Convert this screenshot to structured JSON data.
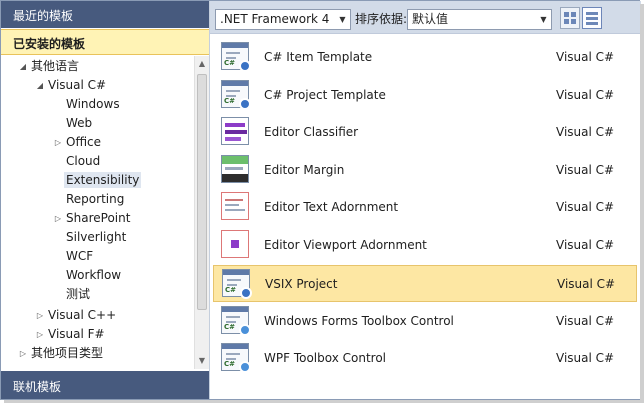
{
  "left_panel": {
    "recent_header": "最近的模板",
    "installed_header": "已安装的模板",
    "online_header": "联机模板",
    "tree": [
      {
        "label": "其他语言",
        "expanded": true,
        "depth": 0
      },
      {
        "label": "Visual C#",
        "expanded": true,
        "depth": 1
      },
      {
        "label": "Windows",
        "depth": 2
      },
      {
        "label": "Web",
        "depth": 2
      },
      {
        "label": "Office",
        "expanded": false,
        "depth": 2
      },
      {
        "label": "Cloud",
        "depth": 2
      },
      {
        "label": "Extensibility",
        "depth": 2,
        "selected": true
      },
      {
        "label": "Reporting",
        "depth": 2
      },
      {
        "label": "SharePoint",
        "expanded": false,
        "depth": 2
      },
      {
        "label": "Silverlight",
        "depth": 2
      },
      {
        "label": "WCF",
        "depth": 2
      },
      {
        "label": "Workflow",
        "depth": 2
      },
      {
        "label": "测试",
        "depth": 2
      },
      {
        "label": "Visual C++",
        "expanded": false,
        "depth": 1
      },
      {
        "label": "Visual F#",
        "expanded": false,
        "depth": 1
      },
      {
        "label": "其他项目类型",
        "expanded": false,
        "depth": 0
      }
    ]
  },
  "toolbar": {
    "framework": ".NET Framework 4",
    "sort_label": "排序依据:",
    "sort_value": "默认值"
  },
  "templates": [
    {
      "name": "C# Item Template",
      "language": "Visual C#",
      "icon": "item-template-icon"
    },
    {
      "name": "C# Project Template",
      "language": "Visual C#",
      "icon": "project-template-icon"
    },
    {
      "name": "Editor Classifier",
      "language": "Visual C#",
      "icon": "editor-classifier-icon"
    },
    {
      "name": "Editor Margin",
      "language": "Visual C#",
      "icon": "editor-margin-icon"
    },
    {
      "name": "Editor Text Adornment",
      "language": "Visual C#",
      "icon": "editor-text-adornment-icon"
    },
    {
      "name": "Editor Viewport Adornment",
      "language": "Visual C#",
      "icon": "editor-viewport-adornment-icon"
    },
    {
      "name": "VSIX Project",
      "language": "Visual C#",
      "icon": "vsix-project-icon",
      "selected": true
    },
    {
      "name": "Windows Forms Toolbox Control",
      "language": "Visual C#",
      "icon": "winforms-toolbox-control-icon"
    },
    {
      "name": "WPF Toolbox Control",
      "language": "Visual C#",
      "icon": "wpf-toolbox-control-icon"
    }
  ],
  "colors": {
    "header_bg": "#475a7e",
    "installed_bg": "#fff3b5",
    "selected_row_bg": "#fde7a3",
    "toolbar_bg": "#d2dbe8"
  }
}
